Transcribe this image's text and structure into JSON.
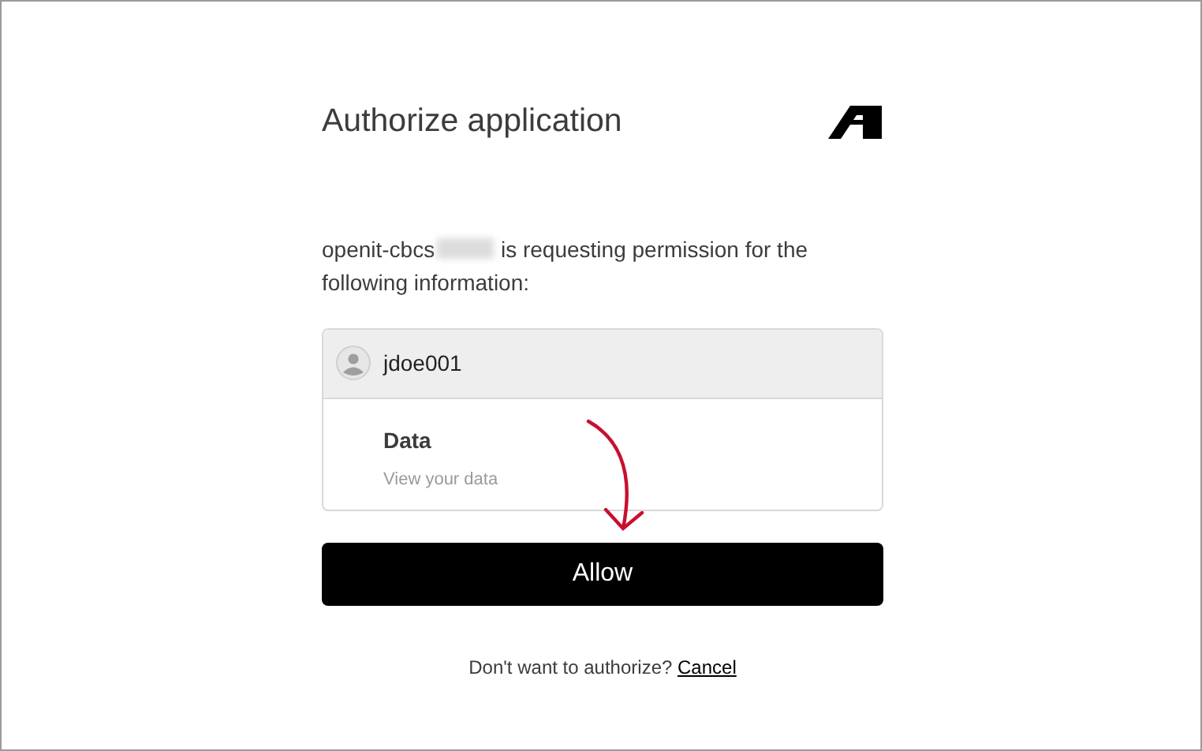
{
  "title": "Authorize application",
  "request": {
    "app_name": "openit-cbcs",
    "app_name_redacted": true,
    "message": "is requesting permission for the following information:"
  },
  "account": {
    "username": "jdoe001"
  },
  "permissions": [
    {
      "name": "Data",
      "description": "View your data"
    }
  ],
  "allow_button": "Allow",
  "footer": {
    "question": "Don't want to authorize?",
    "cancel_link": "Cancel"
  }
}
